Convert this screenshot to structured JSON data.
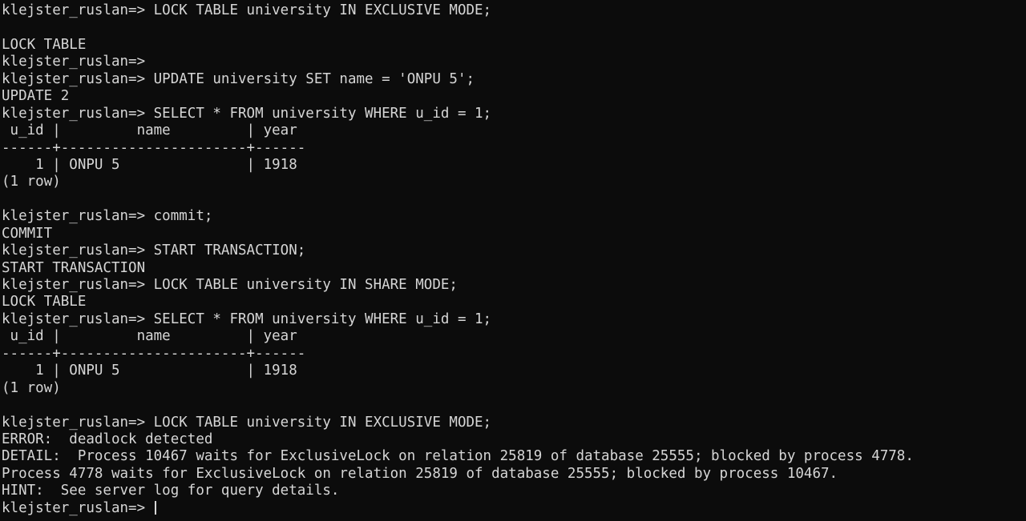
{
  "terminal": {
    "prompt": "klejster_ruslan=> ",
    "lines": [
      "klejster_ruslan=> LOCK TABLE university IN EXCLUSIVE MODE;",
      "",
      "LOCK TABLE",
      "klejster_ruslan=>",
      "klejster_ruslan=> UPDATE university SET name = 'ONPU 5';",
      "UPDATE 2",
      "klejster_ruslan=> SELECT * FROM university WHERE u_id = 1;",
      " u_id |         name         | year",
      "------+----------------------+------",
      "    1 | ONPU 5               | 1918",
      "(1 row)",
      "",
      "klejster_ruslan=> commit;",
      "COMMIT",
      "klejster_ruslan=> START TRANSACTION;",
      "START TRANSACTION",
      "klejster_ruslan=> LOCK TABLE university IN SHARE MODE;",
      "LOCK TABLE",
      "klejster_ruslan=> SELECT * FROM university WHERE u_id = 1;",
      " u_id |         name         | year",
      "------+----------------------+------",
      "    1 | ONPU 5               | 1918",
      "(1 row)",
      "",
      "klejster_ruslan=> LOCK TABLE university IN EXCLUSIVE MODE;",
      "ERROR:  deadlock detected",
      "DETAIL:  Process 10467 waits for ExclusiveLock on relation 25819 of database 25555; blocked by process 4778.",
      "Process 4778 waits for ExclusiveLock on relation 25819 of database 25555; blocked by process 10467.",
      "HINT:  See server log for query details."
    ]
  }
}
